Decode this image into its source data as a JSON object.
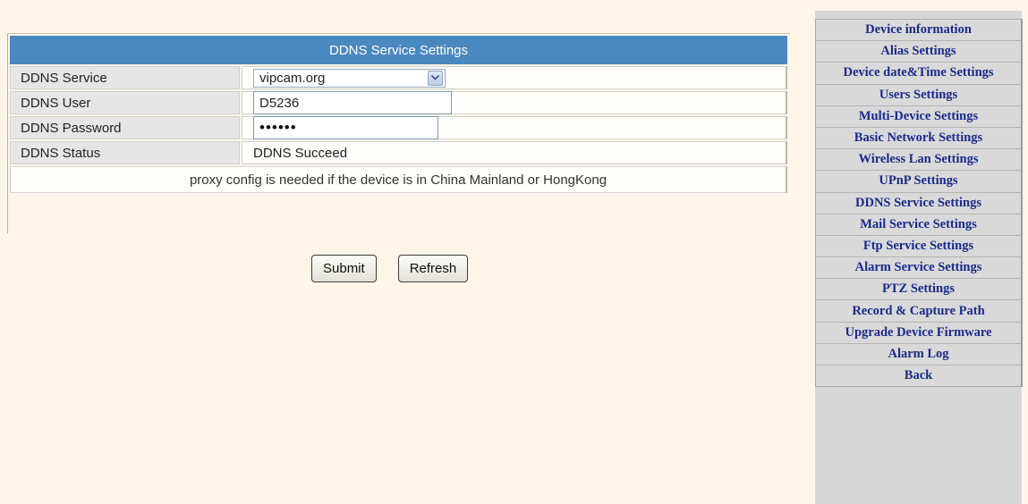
{
  "form": {
    "title": "DDNS Service Settings",
    "rows": [
      {
        "label": "DDNS Service",
        "value": "vipcam.org",
        "type": "select"
      },
      {
        "label": "DDNS User",
        "value": "D5236",
        "type": "text"
      },
      {
        "label": "DDNS Password",
        "value": "••••••",
        "type": "password"
      },
      {
        "label": "DDNS Status",
        "value": "DDNS Succeed",
        "type": "static"
      }
    ],
    "note": "proxy config is needed if the device is in China Mainland or HongKong",
    "submit_label": "Submit",
    "refresh_label": "Refresh"
  },
  "menu": {
    "items": [
      "Device information",
      "Alias Settings",
      "Device date&Time Settings",
      "Users Settings",
      "Multi-Device Settings",
      "Basic Network Settings",
      "Wireless Lan Settings",
      "UPnP Settings",
      "DDNS Service Settings",
      "Mail Service Settings",
      "Ftp Service Settings",
      "Alarm Service Settings",
      "PTZ Settings",
      "Record & Capture Path",
      "Upgrade Device Firmware",
      "Alarm Log",
      "Back"
    ]
  },
  "colors": {
    "header_bg": "#4a88c0",
    "page_bg": "#fdf6e8",
    "menu_text": "#1a2a8c",
    "menu_bg": "#d9d9d9"
  },
  "icons": {
    "select_arrow": "chevron-down-icon"
  }
}
